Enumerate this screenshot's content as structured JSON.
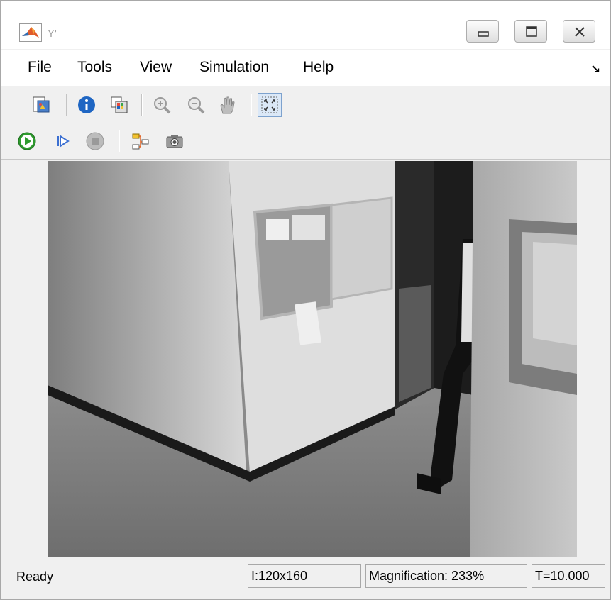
{
  "window": {
    "title": "Y'",
    "controls": {
      "minimize": "minimize-icon",
      "maximize": "maximize-icon",
      "close": "close-icon"
    }
  },
  "menu": {
    "items": [
      "File",
      "Tools",
      "View",
      "Simulation",
      "Help"
    ],
    "overflow_arrow": "↘"
  },
  "toolbar1": {
    "tools": [
      "print-to-figure-icon",
      "info-icon",
      "colormap-icon",
      "zoom-in-icon",
      "zoom-out-icon",
      "pan-hand-icon",
      "fit-to-view-icon"
    ],
    "pressed": "fit-to-view-icon"
  },
  "toolbar2": {
    "tools": [
      "run-icon",
      "step-forward-icon",
      "stop-icon",
      "highlight-model-icon",
      "snapshot-icon"
    ],
    "run_color": "#2e9b2e"
  },
  "status": {
    "state": "Ready",
    "image_size": "I:120x160",
    "magnification": "Magnification: 233%",
    "time": "T=10.000"
  }
}
